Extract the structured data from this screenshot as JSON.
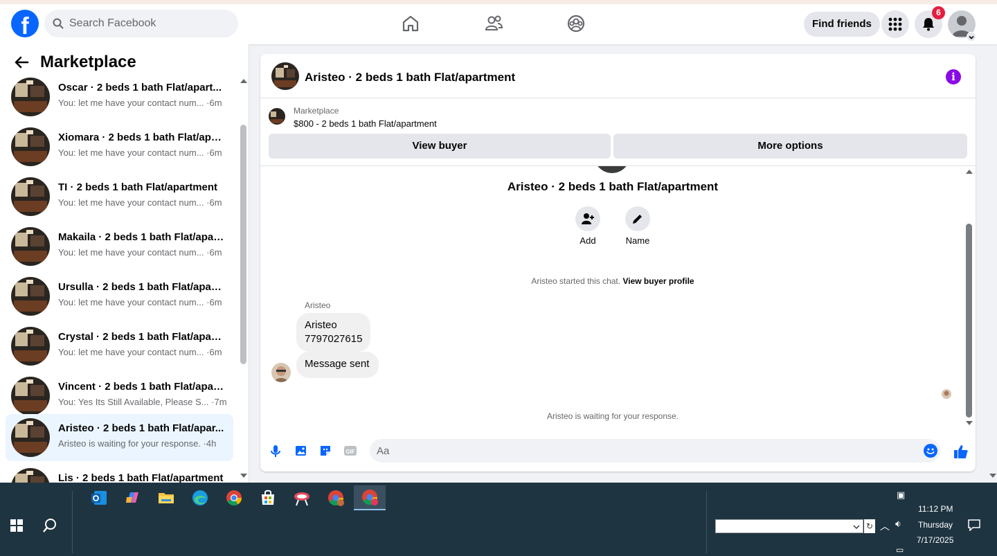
{
  "topbar": {
    "logo": "f",
    "search_placeholder": "Search Facebook",
    "find_friends_label": "Find friends",
    "notification_count": "6",
    "icons": [
      "home-icon",
      "friends-icon",
      "groups-icon",
      "menu-grid-icon",
      "bell-icon"
    ]
  },
  "sidebar": {
    "title": "Marketplace",
    "conversations": [
      {
        "name": "Oscar · 2 beds 1 bath Flat/apart...",
        "preview": "You: let me have your contact num... ·6m"
      },
      {
        "name": "Xiomara · 2 beds 1 bath Flat/apa...",
        "preview": "You: let me have your contact num... ·6m"
      },
      {
        "name": "TI · 2 beds 1 bath Flat/apartment",
        "preview": "You: let me have your contact num... ·6m"
      },
      {
        "name": "Makaila · 2 beds 1 bath Flat/apar...",
        "preview": "You: let me have your contact num... ·6m"
      },
      {
        "name": "Ursulla · 2 beds 1 bath Flat/apart...",
        "preview": "You: let me have your contact num... ·6m"
      },
      {
        "name": "Crystal · 2 beds 1 bath Flat/apart...",
        "preview": "You: let me have your contact num... ·6m"
      },
      {
        "name": "Vincent · 2 beds 1 bath Flat/apar...",
        "preview": "You: Yes Its Still Available, Please S... ·7m"
      },
      {
        "name": "Aristeo · 2 beds 1 bath Flat/apar...",
        "preview": "Aristeo is waiting for your response. ·4h"
      },
      {
        "name": "Lis · 2 beds 1 bath Flat/apartment",
        "preview": ""
      }
    ]
  },
  "chat": {
    "title": "Aristeo · 2 beds 1 bath Flat/apartment",
    "marketplace_label": "Marketplace",
    "listing": "$800 - 2 beds 1 bath Flat/apartment",
    "view_buyer_label": "View buyer",
    "more_options_label": "More options",
    "center_title": "Aristeo · 2 beds 1 bath Flat/apartment",
    "add_label": "Add",
    "name_label": "Name",
    "started_text": "Aristeo started this chat.",
    "view_profile_link": "View buyer profile",
    "sender_name": "Aristeo",
    "message_line1": "Aristeo",
    "message_line2": "7797027615",
    "message2": "Message sent",
    "waiting_text": "Aristeo is waiting for your response.",
    "composer_placeholder": "Aa",
    "gif_label": "GIF"
  },
  "taskbar": {
    "time": "11:12 PM",
    "day": "Thursday",
    "date": "7/17/2025",
    "apps": [
      "outlook-icon",
      "copilot-icon",
      "file-explorer-icon",
      "edge-icon",
      "chrome-icon",
      "store-icon",
      "snipping-icon",
      "chrome-profile-icon",
      "chrome-active-icon"
    ]
  },
  "colors": {
    "brand": "#0866ff",
    "badge": "#e41e3f",
    "info": "#8a0ae6",
    "taskbar": "#1f3441"
  }
}
